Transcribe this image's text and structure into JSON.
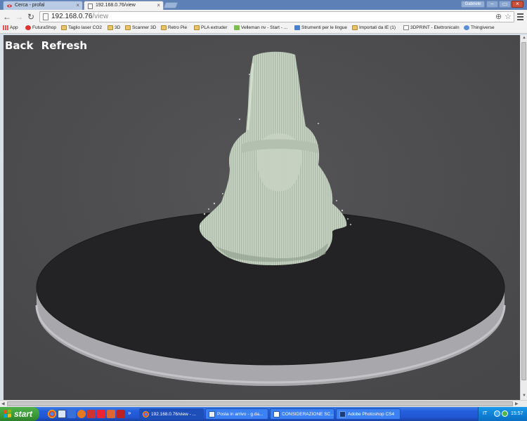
{
  "browser": {
    "tabs": [
      {
        "title": "Cerca - profal",
        "active": false
      },
      {
        "title": "192.168.0.76/view",
        "active": true
      }
    ],
    "profile_name": "Gabriele",
    "url_host": "192.168.0.76",
    "url_path": "/view"
  },
  "bookmarks": [
    {
      "label": "App",
      "icon": "apps-grid-icon"
    },
    {
      "label": "FuturaShop",
      "icon": "red-eye-icon"
    },
    {
      "label": "Taglio laser CO2",
      "icon": "folder-icon"
    },
    {
      "label": "3D",
      "icon": "folder-icon"
    },
    {
      "label": "Scanner 3D",
      "icon": "folder-icon"
    },
    {
      "label": "Retro Pie",
      "icon": "folder-icon"
    },
    {
      "label": "PLA extruder",
      "icon": "folder-icon"
    },
    {
      "label": "Velleman nv - Start - ...",
      "icon": "velleman-icon"
    },
    {
      "label": "Strumenti per le lingue",
      "icon": "translate-icon"
    },
    {
      "label": "Importati da IE (1)",
      "icon": "folder-icon"
    },
    {
      "label": "3DPRINT - ElettronicaIn",
      "icon": "page-icon"
    },
    {
      "label": "Thingiverse",
      "icon": "thingiverse-icon"
    }
  ],
  "page": {
    "links": {
      "back": "Back",
      "refresh": "Refresh"
    },
    "scene": {
      "background": "#4c4c4f",
      "turntable_top": "#232325",
      "turntable_side": "#a9a9ad",
      "model_color": "#c8d4c4"
    }
  },
  "taskbar": {
    "start_label": "start",
    "tasks": [
      {
        "label": "192.168.0.76/view - ...",
        "icon": "chrome-icon",
        "active": true
      },
      {
        "label": "Posta in arrivo - g.da...",
        "icon": "outlook-icon",
        "active": false
      },
      {
        "label": "CONSIDERAZIONE SC...",
        "icon": "word-icon",
        "active": false
      },
      {
        "label": "Adobe Photoshop CS4",
        "icon": "photoshop-icon",
        "active": false
      }
    ],
    "language": "IT",
    "clock": "15:57"
  }
}
